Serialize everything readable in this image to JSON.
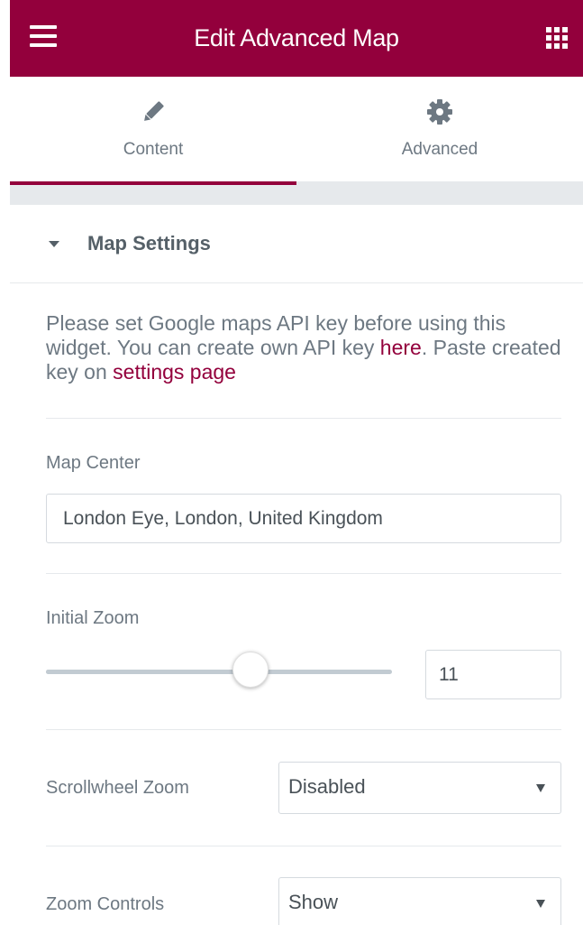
{
  "header": {
    "title": "Edit Advanced Map",
    "menu_icon": "hamburger-icon",
    "apps_icon": "grid-icon",
    "color": "#93003c"
  },
  "tabs": [
    {
      "label": "Content",
      "icon": "pencil-icon",
      "active": true
    },
    {
      "label": "Advanced",
      "icon": "gear-icon",
      "active": false
    }
  ],
  "section": {
    "title": "Map Settings",
    "icon": "caret-down-icon"
  },
  "notice": {
    "text_1": "Please set Google maps API key before using this widget. You can create own API key ",
    "link_1": "here",
    "text_2": ". Paste created key on ",
    "link_2": "settings page"
  },
  "map_center": {
    "label": "Map Center",
    "value": "London Eye, London, United Kingdom"
  },
  "initial_zoom": {
    "label": "Initial Zoom",
    "value": "11",
    "slider_fraction": 0.59
  },
  "scrollwheel_zoom": {
    "label": "Scrollwheel Zoom",
    "value": "Disabled"
  },
  "zoom_controls": {
    "label": "Zoom Controls",
    "value": "Show"
  }
}
